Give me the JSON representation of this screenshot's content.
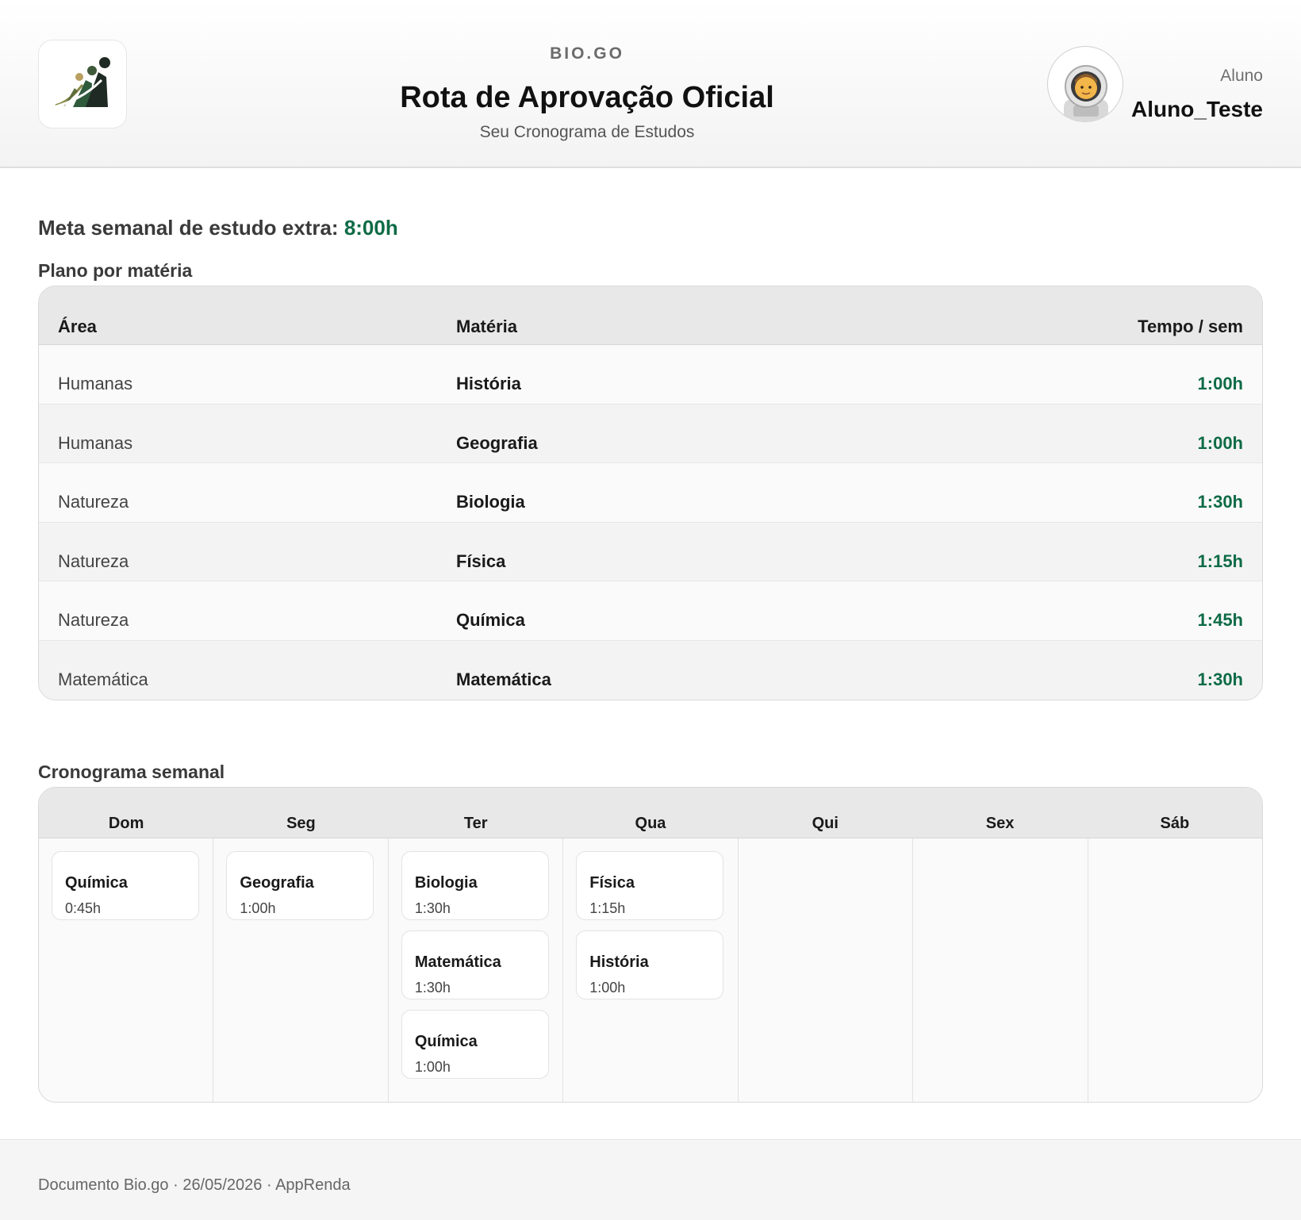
{
  "header": {
    "brand": "BIO.GO",
    "title": "Rota de Aprovação Oficial",
    "subtitle": "Seu Cronograma de Estudos",
    "user_role": "Aluno",
    "user_name": "Aluno_Teste"
  },
  "goal": {
    "label": "Meta semanal de estudo extra:",
    "value": "8:00h"
  },
  "plan": {
    "title": "Plano por matéria",
    "columns": {
      "area": "Área",
      "subject": "Matéria",
      "time": "Tempo / sem"
    },
    "rows": [
      {
        "area": "Humanas",
        "subject": "História",
        "time": "1:00h"
      },
      {
        "area": "Humanas",
        "subject": "Geografia",
        "time": "1:00h"
      },
      {
        "area": "Natureza",
        "subject": "Biologia",
        "time": "1:30h"
      },
      {
        "area": "Natureza",
        "subject": "Física",
        "time": "1:15h"
      },
      {
        "area": "Natureza",
        "subject": "Química",
        "time": "1:45h"
      },
      {
        "area": "Matemática",
        "subject": "Matemática",
        "time": "1:30h"
      }
    ]
  },
  "schedule": {
    "title": "Cronograma semanal",
    "days": [
      {
        "name": "Dom",
        "sessions": [
          {
            "subject": "Química",
            "time": "0:45h"
          }
        ]
      },
      {
        "name": "Seg",
        "sessions": [
          {
            "subject": "Geografia",
            "time": "1:00h"
          }
        ]
      },
      {
        "name": "Ter",
        "sessions": [
          {
            "subject": "Biologia",
            "time": "1:30h"
          },
          {
            "subject": "Matemática",
            "time": "1:30h"
          },
          {
            "subject": "Química",
            "time": "1:00h"
          }
        ]
      },
      {
        "name": "Qua",
        "sessions": [
          {
            "subject": "Física",
            "time": "1:15h"
          },
          {
            "subject": "História",
            "time": "1:00h"
          }
        ]
      },
      {
        "name": "Qui",
        "sessions": []
      },
      {
        "name": "Sex",
        "sessions": []
      },
      {
        "name": "Sáb",
        "sessions": []
      }
    ]
  },
  "footer": {
    "text": "Documento Bio.go · 26/05/2026 · AppRenda"
  },
  "colors": {
    "accent_green": "#0e6b46",
    "header_bg": "#f3f3f3",
    "table_head_bg": "#e8e8e8"
  },
  "icons": {
    "logo": "growth-chart-logo-icon",
    "avatar": "astronaut-avatar-icon"
  }
}
